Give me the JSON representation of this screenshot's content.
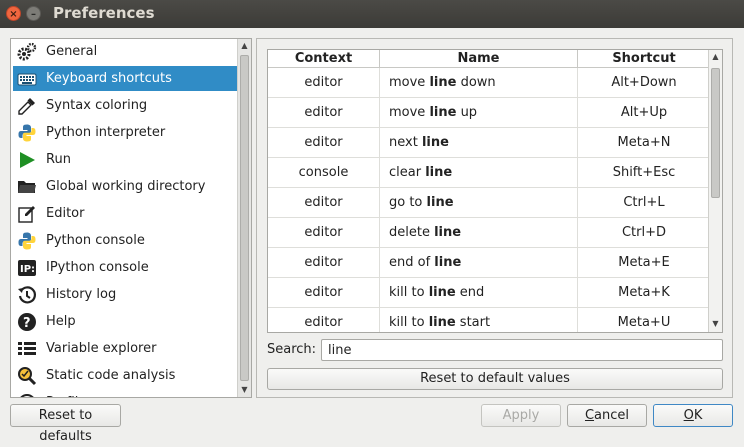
{
  "window": {
    "title": "Preferences"
  },
  "sidebar": {
    "items": [
      {
        "label": "General",
        "icon": "gears-icon"
      },
      {
        "label": "Keyboard shortcuts",
        "icon": "keyboard-icon",
        "selected": true
      },
      {
        "label": "Syntax coloring",
        "icon": "eyedropper-icon"
      },
      {
        "label": "Python interpreter",
        "icon": "python-icon"
      },
      {
        "label": "Run",
        "icon": "play-icon"
      },
      {
        "label": "Global working directory",
        "icon": "folder-icon"
      },
      {
        "label": "Editor",
        "icon": "edit-icon"
      },
      {
        "label": "Python console",
        "icon": "python-icon"
      },
      {
        "label": "IPython console",
        "icon": "ipython-icon"
      },
      {
        "label": "History log",
        "icon": "history-icon"
      },
      {
        "label": "Help",
        "icon": "help-icon"
      },
      {
        "label": "Variable explorer",
        "icon": "table-icon"
      },
      {
        "label": "Static code analysis",
        "icon": "magnifier-icon"
      },
      {
        "label": "Profiler",
        "icon": "profiler-icon"
      }
    ]
  },
  "shortcuts": {
    "headers": {
      "context": "Context",
      "name": "Name",
      "shortcut": "Shortcut"
    },
    "rows": [
      {
        "context": "editor",
        "pre": "move ",
        "match": "line",
        "post": " down",
        "shortcut": "Alt+Down"
      },
      {
        "context": "editor",
        "pre": "move ",
        "match": "line",
        "post": " up",
        "shortcut": "Alt+Up"
      },
      {
        "context": "editor",
        "pre": "next ",
        "match": "line",
        "post": "",
        "shortcut": "Meta+N"
      },
      {
        "context": "console",
        "pre": "clear ",
        "match": "line",
        "post": "",
        "shortcut": "Shift+Esc"
      },
      {
        "context": "editor",
        "pre": "go to ",
        "match": "line",
        "post": "",
        "shortcut": "Ctrl+L"
      },
      {
        "context": "editor",
        "pre": "delete ",
        "match": "line",
        "post": "",
        "shortcut": "Ctrl+D"
      },
      {
        "context": "editor",
        "pre": "end of ",
        "match": "line",
        "post": "",
        "shortcut": "Meta+E"
      },
      {
        "context": "editor",
        "pre": "kill to ",
        "match": "line",
        "post": " end",
        "shortcut": "Meta+K"
      },
      {
        "context": "editor",
        "pre": "kill to ",
        "match": "line",
        "post": " start",
        "shortcut": "Meta+U"
      }
    ]
  },
  "search": {
    "label": "Search:",
    "value": "line"
  },
  "buttons": {
    "reset_table": "Reset to default values",
    "reset_defaults": "Reset to defaults",
    "apply": "Apply",
    "cancel_underline": "C",
    "cancel_rest": "ancel",
    "ok_underline": "O",
    "ok_rest": "K"
  },
  "colors": {
    "selection": "#308cc6",
    "titlebar": "#3c3b37",
    "close": "#f0663f"
  }
}
